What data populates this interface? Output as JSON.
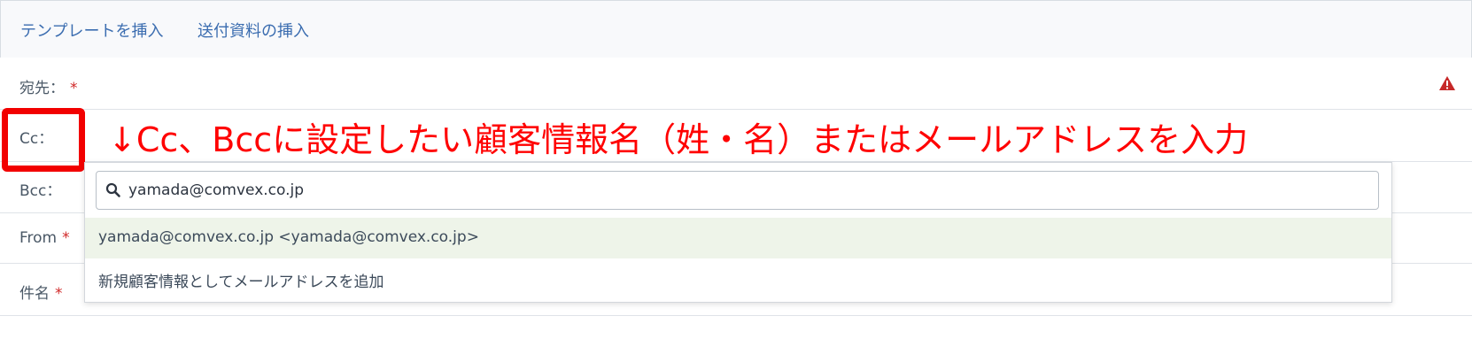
{
  "toolbar": {
    "insert_template": "テンプレートを挿入",
    "insert_attachment": "送付資料の挿入"
  },
  "fields": {
    "to_label": "宛先：",
    "cc_label": "Cc：",
    "bcc_label": "Bcc：",
    "from_label": "From",
    "subject_label": "件名",
    "required_mark": "*"
  },
  "annotation": {
    "text": "↓Cc、Bccに設定したい顧客情報名（姓・名）またはメールアドレスを入力"
  },
  "dropdown": {
    "search_value": "yamada@comvex.co.jp",
    "options": [
      "yamada@comvex.co.jp <yamada@comvex.co.jp>",
      "新規顧客情報としてメールアドレスを追加"
    ]
  },
  "icons": {
    "warning": "warning-icon",
    "search": "search-icon"
  },
  "colors": {
    "link": "#3b6db0",
    "required": "#d02828",
    "annotation": "#ff0000",
    "warning": "#c62828",
    "option_highlight": "#eef4e9"
  }
}
